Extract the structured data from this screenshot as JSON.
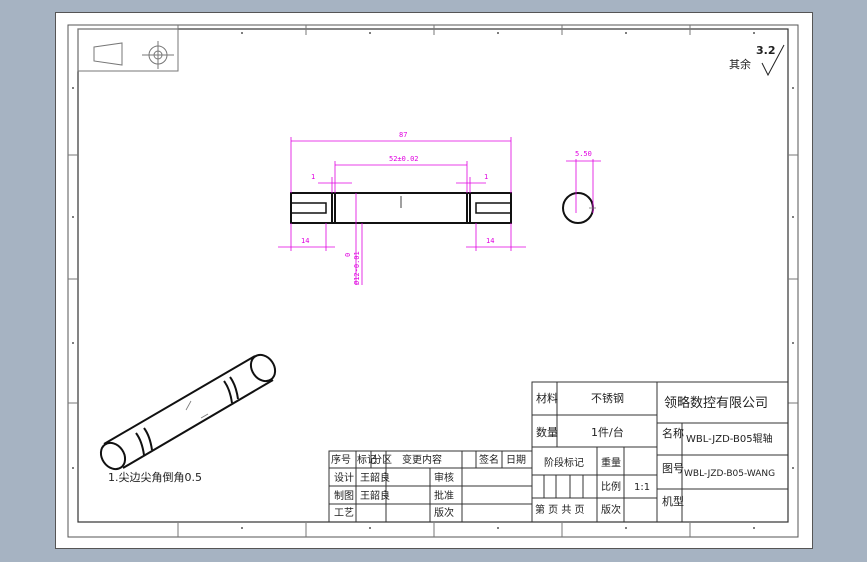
{
  "roughness": {
    "value": "3.2",
    "prefix": "其余"
  },
  "dimensions": {
    "overall_length": "87",
    "middle_length": "52±0.02",
    "groove_left": "1",
    "groove_right": "1",
    "end_left": "14",
    "end_right": "14",
    "diameter": "Ø12-0.01",
    "diameter_tol": "0",
    "side_width": "5.50"
  },
  "notes": {
    "chamfer": "1.尖边尖角倒角0.5"
  },
  "title_block": {
    "material_label": "材料",
    "material_value": "不锈钢",
    "quantity_label": "数量",
    "quantity_value": "1件/台",
    "company": "领略数控有限公司",
    "name_label": "名称",
    "name_value": "WBL-JZD-B05辊轴",
    "drawing_no_label": "图号",
    "drawing_no_value": "WBL-JZD-B05-WANG",
    "model_label": "机型",
    "stage_label": "阶段标记",
    "weight_label": "重量",
    "scale_label": "比例",
    "scale_value": "1:1",
    "pages_label": "第 页 共 页",
    "version_label": "版次",
    "rev_headers": [
      "序号",
      "标记",
      "分区",
      "变更内容",
      "签名",
      "日期"
    ],
    "design_label": "设计",
    "design_name": "王韶良",
    "draft_label": "制图",
    "draft_name": "王韶良",
    "process_label": "工艺",
    "check_label": "审核",
    "approve_label": "批准",
    "revision_label": "版次"
  }
}
